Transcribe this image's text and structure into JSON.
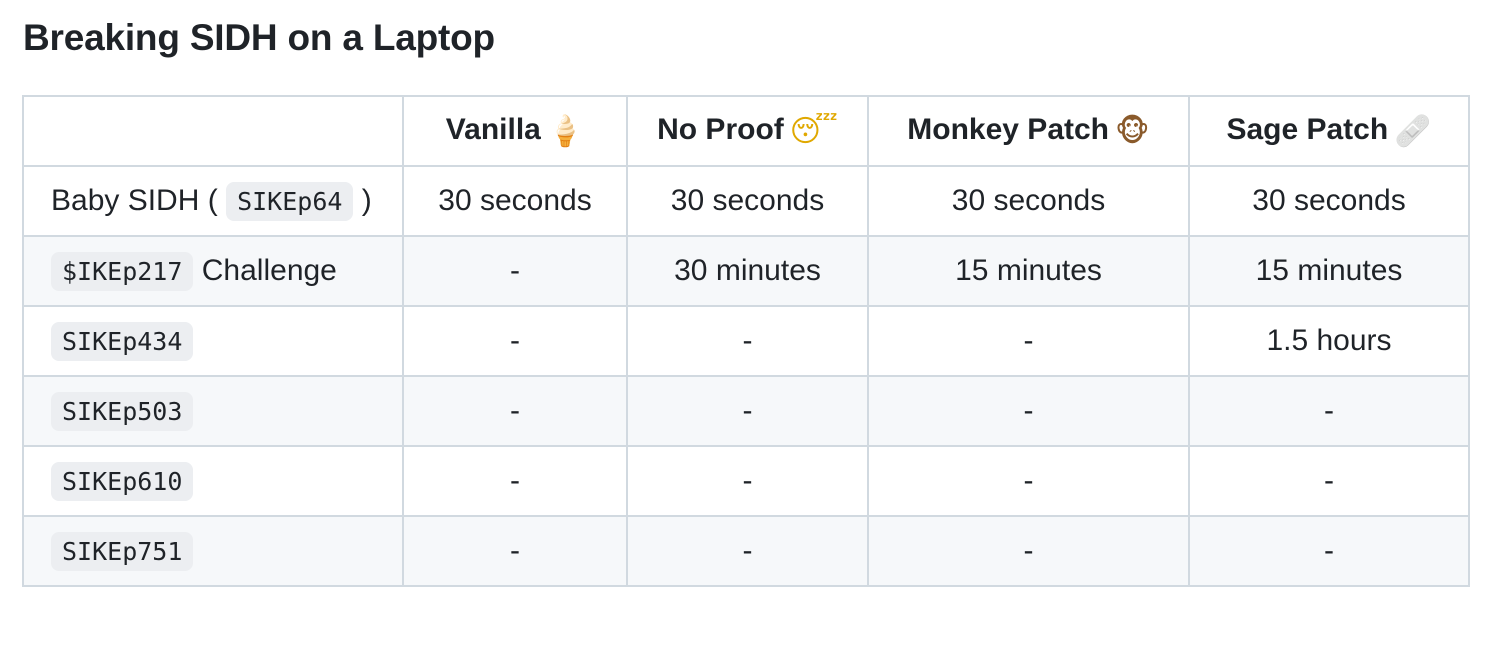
{
  "title": "Breaking SIDH on a Laptop",
  "table": {
    "headers": [
      {
        "label": "",
        "emoji": "",
        "emoji_name": ""
      },
      {
        "label": "Vanilla",
        "emoji": "🍦",
        "emoji_name": "ice-cream-icon"
      },
      {
        "label": "No Proof",
        "emoji": "😴",
        "emoji_name": "sleeping-face-icon"
      },
      {
        "label": "Monkey Patch",
        "emoji": "🐵",
        "emoji_name": "monkey-face-icon"
      },
      {
        "label": "Sage Patch",
        "emoji": "🩹",
        "emoji_name": "bandage-icon"
      }
    ],
    "rows": [
      {
        "prefix": "Baby SIDH (",
        "code": "SIKEp64",
        "suffix": ")",
        "values": [
          "30 seconds",
          "30 seconds",
          "30 seconds",
          "30 seconds"
        ]
      },
      {
        "prefix": "",
        "code": "$IKEp217",
        "suffix": "Challenge",
        "values": [
          "-",
          "30 minutes",
          "15 minutes",
          "15 minutes"
        ]
      },
      {
        "prefix": "",
        "code": "SIKEp434",
        "suffix": "",
        "values": [
          "-",
          "-",
          "-",
          "1.5 hours"
        ]
      },
      {
        "prefix": "",
        "code": "SIKEp503",
        "suffix": "",
        "values": [
          "-",
          "-",
          "-",
          "-"
        ]
      },
      {
        "prefix": "",
        "code": "SIKEp610",
        "suffix": "",
        "values": [
          "-",
          "-",
          "-",
          "-"
        ]
      },
      {
        "prefix": "",
        "code": "SIKEp751",
        "suffix": "",
        "values": [
          "-",
          "-",
          "-",
          "-"
        ]
      }
    ]
  },
  "colors": {
    "text": "#1f2328",
    "border": "#d1d9e0",
    "stripe": "#f6f8fa",
    "code_bg": "#eceef1"
  }
}
